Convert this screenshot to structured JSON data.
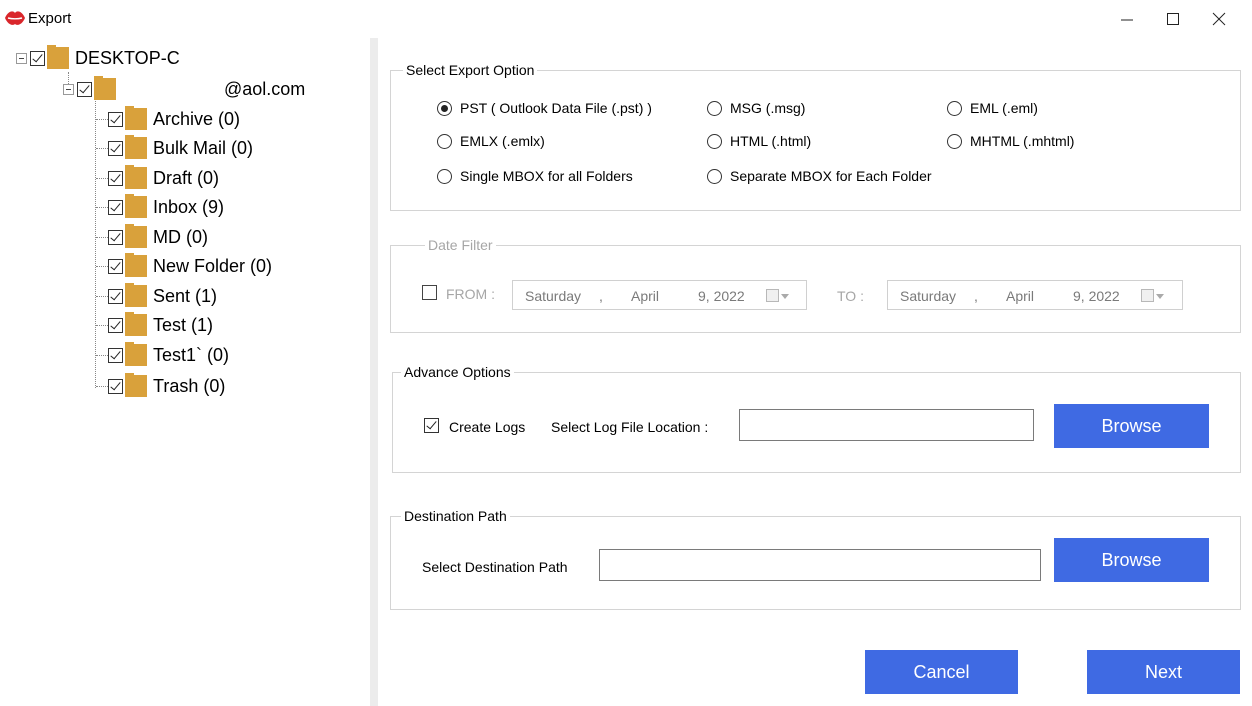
{
  "window": {
    "title": "Export",
    "icons": {
      "app": "app-lips-icon",
      "minimize": "minimize-icon",
      "maximize": "maximize-icon",
      "close": "close-icon"
    }
  },
  "tree": {
    "root": {
      "label": "DESKTOP-C",
      "checked": true
    },
    "account": {
      "label": "@aol.com",
      "checked": true
    },
    "folders": [
      {
        "label": "Archive (0)",
        "checked": true
      },
      {
        "label": "Bulk Mail (0)",
        "checked": true
      },
      {
        "label": "Draft (0)",
        "checked": true
      },
      {
        "label": "Inbox (9)",
        "checked": true
      },
      {
        "label": "MD (0)",
        "checked": true
      },
      {
        "label": "New Folder (0)",
        "checked": true
      },
      {
        "label": "Sent (1)",
        "checked": true
      },
      {
        "label": "Test (1)",
        "checked": true
      },
      {
        "label": "Test1` (0)",
        "checked": true
      },
      {
        "label": "Trash (0)",
        "checked": true
      }
    ]
  },
  "export_option": {
    "title": "Select Export Option",
    "options": [
      {
        "label": "PST ( Outlook Data File (.pst) )",
        "selected": true
      },
      {
        "label": "MSG  (.msg)",
        "selected": false
      },
      {
        "label": "EML  (.eml)",
        "selected": false
      },
      {
        "label": "EMLX  (.emlx)",
        "selected": false
      },
      {
        "label": "HTML  (.html)",
        "selected": false
      },
      {
        "label": "MHTML (.mhtml)",
        "selected": false
      },
      {
        "label": "Single MBOX for all Folders",
        "selected": false
      },
      {
        "label": "Separate MBOX for Each Folder",
        "selected": false
      }
    ]
  },
  "date_filter": {
    "title": "Date Filter",
    "enabled": false,
    "from_label": "FROM :",
    "to_label": "TO :",
    "from": {
      "weekday": "Saturday",
      "comma": ",",
      "month": "April",
      "day_year": "9, 2022"
    },
    "to": {
      "weekday": "Saturday",
      "comma": ",",
      "month": "April",
      "day_year": "9, 2022"
    }
  },
  "advance_options": {
    "title": "Advance Options",
    "create_logs_label": "Create Logs",
    "create_logs_checked": true,
    "log_location_label": "Select Log File Location :",
    "log_location_value": "",
    "browse_label": "Browse"
  },
  "destination": {
    "title": "Destination Path",
    "label": "Select Destination Path",
    "value": "",
    "browse_label": "Browse"
  },
  "footer": {
    "cancel_label": "Cancel",
    "next_label": "Next"
  },
  "colors": {
    "button_blue": "#3f6ae3",
    "folder_gold": "#d9a13b",
    "app_icon_red": "#d9262b"
  }
}
